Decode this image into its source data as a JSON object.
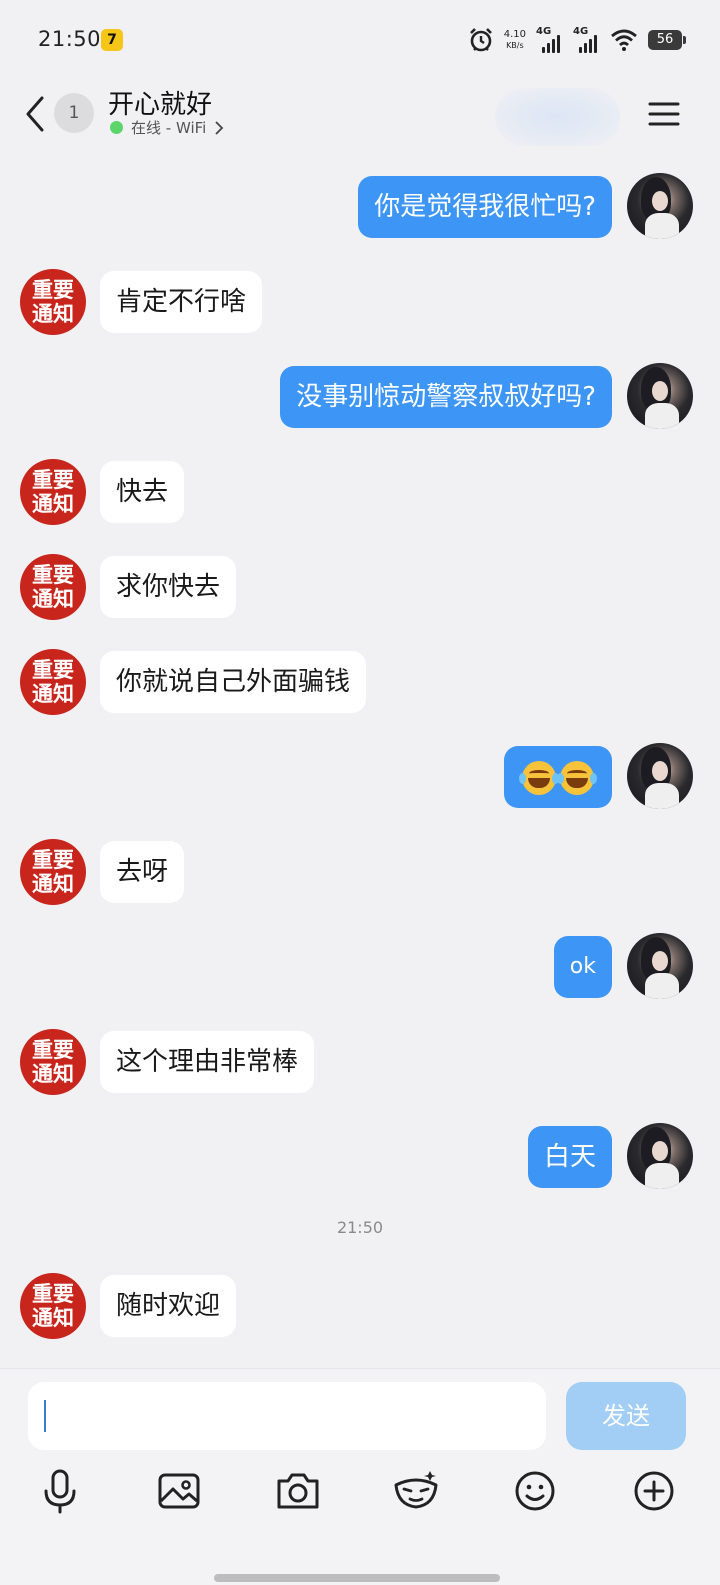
{
  "status_bar": {
    "time": "21:50",
    "app_badge": "7",
    "net_speed_value": "4.10",
    "net_speed_unit": "KB/s",
    "signal1_label": "4G",
    "signal2_label": "4G",
    "battery": "56"
  },
  "header": {
    "unread_count": "1",
    "contact_name": "开心就好",
    "status_text": "在线 - WiFi"
  },
  "avatar_in_text": [
    "重要",
    "通知"
  ],
  "messages": [
    {
      "dir": "out",
      "text": "你是觉得我很忙吗?"
    },
    {
      "dir": "in",
      "text": "肯定不行啥"
    },
    {
      "dir": "out",
      "text": "没事别惊动警察叔叔好吗?"
    },
    {
      "dir": "in",
      "text": "快去"
    },
    {
      "dir": "in",
      "text": "求你快去"
    },
    {
      "dir": "in",
      "text": "你就说自己外面骗钱"
    },
    {
      "dir": "out",
      "emoji": "tears-of-joy-emoji x2"
    },
    {
      "dir": "in",
      "text": "去呀"
    },
    {
      "dir": "out",
      "text": "ok"
    },
    {
      "dir": "in",
      "text": "这个理由非常棒"
    },
    {
      "dir": "out",
      "text": "白天"
    },
    {
      "dir": "in",
      "text": "随时欢迎"
    }
  ],
  "time_separator": "21:50",
  "input": {
    "value": "",
    "send_label": "发送"
  },
  "toolbar": [
    "microphone-icon",
    "image-icon",
    "camera-icon",
    "sticker-icon",
    "emoji-icon",
    "plus-icon"
  ],
  "colors": {
    "outgoing_bubble": "#3d96f6",
    "incoming_bubble": "#ffffff",
    "background": "#f1f1f4",
    "avatar_badge": "#c8251d",
    "send_disabled": "#a2cdf5",
    "online": "#5bd56b"
  }
}
